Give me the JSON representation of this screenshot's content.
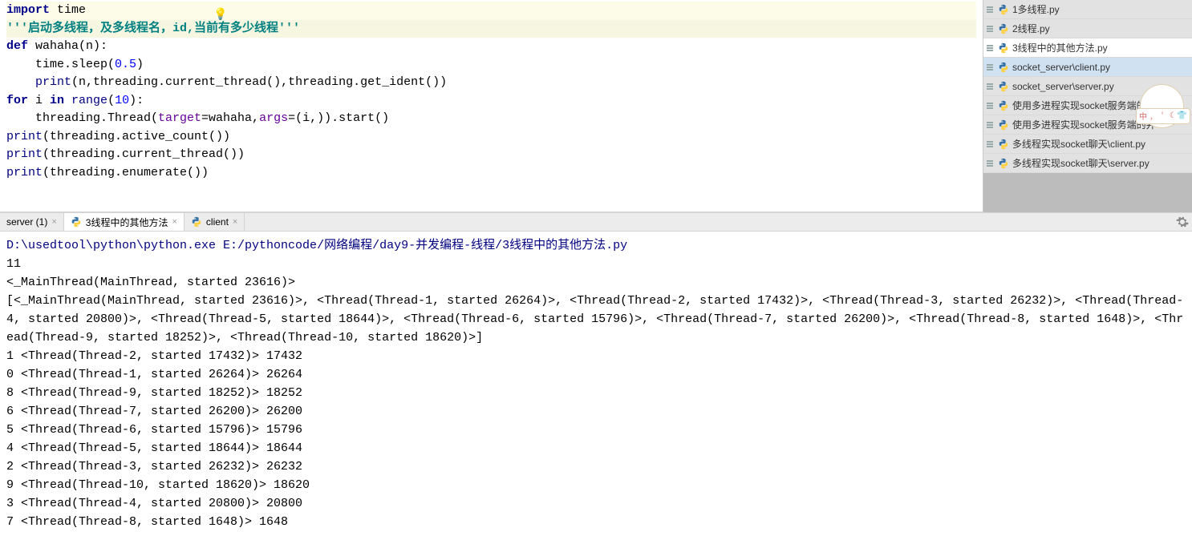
{
  "editor": {
    "code_tokens": [
      [
        {
          "t": "import ",
          "c": "kw"
        },
        {
          "t": "time",
          "c": ""
        }
      ],
      [
        {
          "t": "'''启动多线程，及多线程名，id,当前有多少线程'''",
          "c": "str-doc"
        }
      ],
      [
        {
          "t": "def ",
          "c": "kw"
        },
        {
          "t": "wahaha",
          "c": ""
        },
        {
          "t": "(n):",
          "c": ""
        }
      ],
      [
        {
          "t": "    time.sleep(",
          "c": ""
        },
        {
          "t": "0.5",
          "c": "num"
        },
        {
          "t": ")",
          "c": ""
        }
      ],
      [
        {
          "t": "    ",
          "c": ""
        },
        {
          "t": "print",
          "c": "builtin"
        },
        {
          "t": "(n,threading.current_thread(),threading.get_ident())",
          "c": ""
        }
      ],
      [
        {
          "t": "for ",
          "c": "kw"
        },
        {
          "t": "i ",
          "c": ""
        },
        {
          "t": "in ",
          "c": "kw"
        },
        {
          "t": "range",
          "c": "builtin"
        },
        {
          "t": "(",
          "c": ""
        },
        {
          "t": "10",
          "c": "num"
        },
        {
          "t": "):",
          "c": ""
        }
      ],
      [
        {
          "t": "    threading.Thread(",
          "c": ""
        },
        {
          "t": "target",
          "c": "param"
        },
        {
          "t": "=wahaha,",
          "c": ""
        },
        {
          "t": "args",
          "c": "param"
        },
        {
          "t": "=(i,)).start()",
          "c": ""
        }
      ],
      [
        {
          "t": "print",
          "c": "builtin"
        },
        {
          "t": "(threading.active_count())",
          "c": ""
        }
      ],
      [
        {
          "t": "print",
          "c": "builtin"
        },
        {
          "t": "(threading.current_thread())",
          "c": ""
        }
      ],
      [
        {
          "t": "print",
          "c": "builtin"
        },
        {
          "t": "(threading.enumerate())",
          "c": ""
        }
      ]
    ]
  },
  "sidebar": {
    "items": [
      {
        "label": "1多线程.py",
        "sel": false,
        "blue": false
      },
      {
        "label": "2线程.py",
        "sel": false,
        "blue": false
      },
      {
        "label": "3线程中的其他方法.py",
        "sel": true,
        "blue": false
      },
      {
        "label": "socket_server\\client.py",
        "sel": false,
        "blue": true
      },
      {
        "label": "socket_server\\server.py",
        "sel": false,
        "blue": false
      },
      {
        "label": "使用多进程实现socket服务端的并",
        "sel": false,
        "blue": false
      },
      {
        "label": "使用多进程实现socket服务端的并",
        "sel": false,
        "blue": false
      },
      {
        "label": "多线程实现socket聊天\\client.py",
        "sel": false,
        "blue": false
      },
      {
        "label": "多线程实现socket聊天\\server.py",
        "sel": false,
        "blue": false
      }
    ]
  },
  "tabs": {
    "items": [
      {
        "label": "server (1)",
        "icon": false,
        "active": false
      },
      {
        "label": "3线程中的其他方法",
        "icon": true,
        "active": true
      },
      {
        "label": "client",
        "icon": true,
        "active": false
      }
    ]
  },
  "console": {
    "cmd": "D:\\usedtool\\python\\python.exe E:/pythoncode/网络编程/day9-并发编程-线程/3线程中的其他方法.py",
    "lines": [
      "11",
      "<_MainThread(MainThread, started 23616)>",
      "[<_MainThread(MainThread, started 23616)>, <Thread(Thread-1, started 26264)>, <Thread(Thread-2, started 17432)>, <Thread(Thread-3, started 26232)>, <Thread(Thread-4, started 20800)>, <Thread(Thread-5, started 18644)>, <Thread(Thread-6, started 15796)>, <Thread(Thread-7, started 26200)>, <Thread(Thread-8, started 1648)>, <Thread(Thread-9, started 18252)>, <Thread(Thread-10, started 18620)>]",
      "1 <Thread(Thread-2, started 17432)> 17432",
      "0 <Thread(Thread-1, started 26264)> 26264",
      "8 <Thread(Thread-9, started 18252)> 18252",
      "6 <Thread(Thread-7, started 26200)> 26200",
      "5 <Thread(Thread-6, started 15796)> 15796",
      "4 <Thread(Thread-5, started 18644)> 18644",
      "2 <Thread(Thread-3, started 26232)> 26232",
      "9 <Thread(Thread-10, started 18620)> 18620",
      "3 <Thread(Thread-4, started 20800)> 20800",
      "7 <Thread(Thread-8, started 1648)> 1648"
    ]
  },
  "ime": {
    "badge": "中"
  }
}
